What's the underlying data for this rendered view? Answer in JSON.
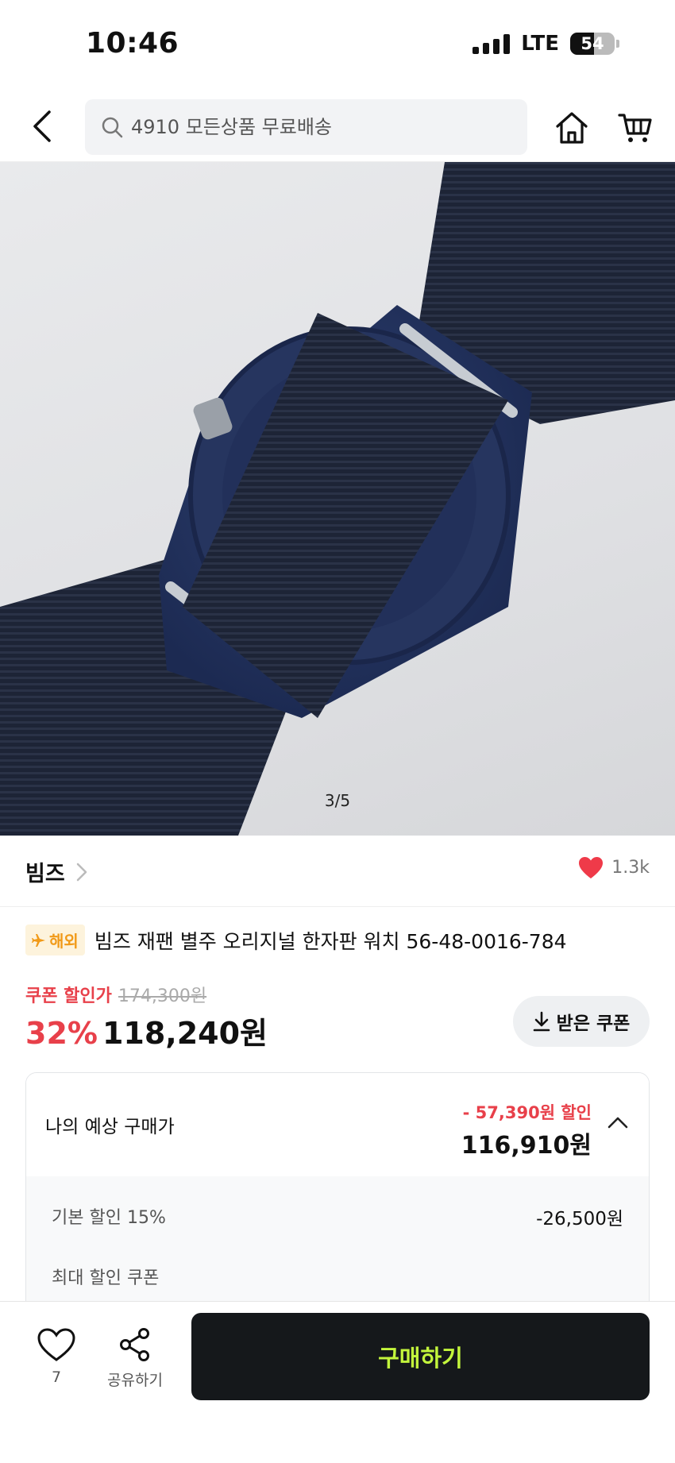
{
  "status_bar": {
    "time": "10:46",
    "network": "LTE",
    "battery": "54"
  },
  "search": {
    "placeholder": "4910 모든상품 무료배송"
  },
  "gallery": {
    "counter": "3/5"
  },
  "brand": {
    "name": "빔즈",
    "like_count": "1.3k"
  },
  "product": {
    "badge": "해외",
    "title": "빔즈 재팬 별주 오리지널 한자판 워치 56-48-0016-784",
    "coupon_label": "쿠폰 할인가",
    "original_price": "174,300원",
    "discount_rate": "32%",
    "sale_price": "118,240원",
    "coupon_button": "받은 쿠폰"
  },
  "expected": {
    "label": "나의 예상 구매가",
    "discount": "- 57,390원 할인",
    "price": "116,910원",
    "rows": [
      {
        "label": "기본 할인 15%",
        "value": "-26,500원"
      },
      {
        "label": "최대 할인 쿠폰",
        "value": ""
      }
    ]
  },
  "bottom_bar": {
    "wish_count": "7",
    "share_label": "공유하기",
    "buy_label": "구매하기"
  },
  "colors": {
    "accent_red": "#e8404a",
    "buy_button_bg": "#15181b",
    "buy_button_text": "#c3f53c",
    "badge_orange": "#f19a18"
  }
}
